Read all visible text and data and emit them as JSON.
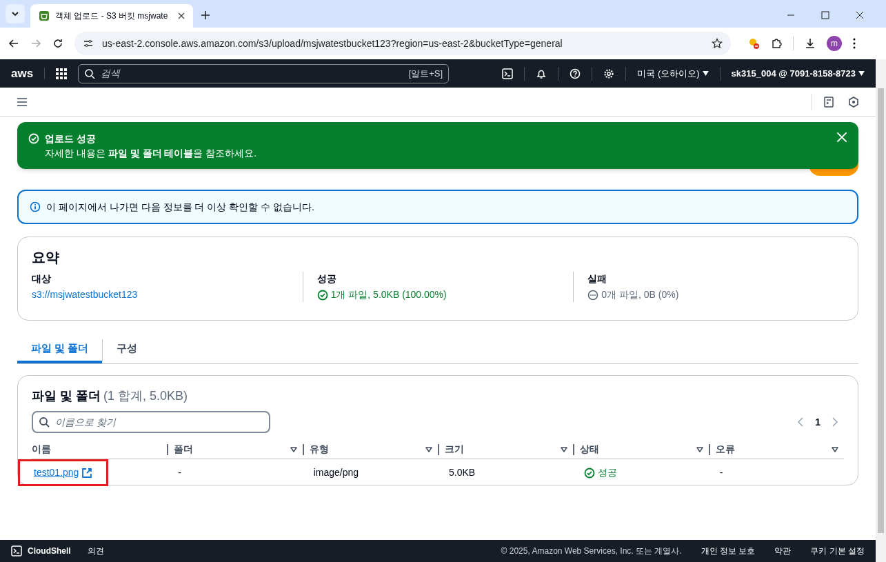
{
  "browser": {
    "tab_title": "객체 업로드 - S3 버킷 msjwate",
    "url": "us-east-2.console.aws.amazon.com/s3/upload/msjwatestbucket123?region=us-east-2&bucketType=general",
    "profile": "m"
  },
  "aws_nav": {
    "logo": "aws",
    "search_placeholder": "검색",
    "shortcut": "[알트+S]",
    "region": "미국 (오하이오)",
    "account": "sk315_004 @ 7091-8158-8723"
  },
  "toast": {
    "title": "업로드 성공",
    "message": "자세한 내용은 **파일 및 폴더 테이블**을 참조하세요."
  },
  "info_alert": "이 페이지에서 나가면 다음 정보를 더 이상 확인할 수 없습니다.",
  "summary": {
    "title": "요약",
    "columns": [
      {
        "label": "대상",
        "value": "s3://msjwatestbucket123",
        "kind": "link"
      },
      {
        "label": "성공",
        "value": "1개 파일, 5.0KB (100.00%)",
        "kind": "success"
      },
      {
        "label": "실패",
        "value": "0개 파일, 0B (0%)",
        "kind": "pending"
      }
    ]
  },
  "tabs": [
    {
      "label": "파일 및 폴더",
      "selected": true
    },
    {
      "label": "구성",
      "selected": false
    }
  ],
  "files": {
    "title": "파일 및 폴더",
    "count": "(1 합계, 5.0KB)",
    "search_placeholder": "이름으로 찾기",
    "page": "1",
    "columns": [
      {
        "label": "이름",
        "sortable": false
      },
      {
        "label": "폴더",
        "sortable": true
      },
      {
        "label": "유형",
        "sortable": true
      },
      {
        "label": "크기",
        "sortable": true
      },
      {
        "label": "상태",
        "sortable": true
      },
      {
        "label": "오류",
        "sortable": true
      }
    ],
    "rows": [
      {
        "name": "test01.png",
        "folder": "-",
        "type": "image/png",
        "size": "5.0KB",
        "status": "성공",
        "error": "-",
        "highlighted": true
      }
    ]
  },
  "footer": {
    "cloudshell": "CloudShell",
    "feedback": "의견",
    "copyright": "© 2025, Amazon Web Services, Inc. 또는 계열사.",
    "links": [
      "개인 정보 보호",
      "약관",
      "쿠키 기본 설정"
    ]
  }
}
